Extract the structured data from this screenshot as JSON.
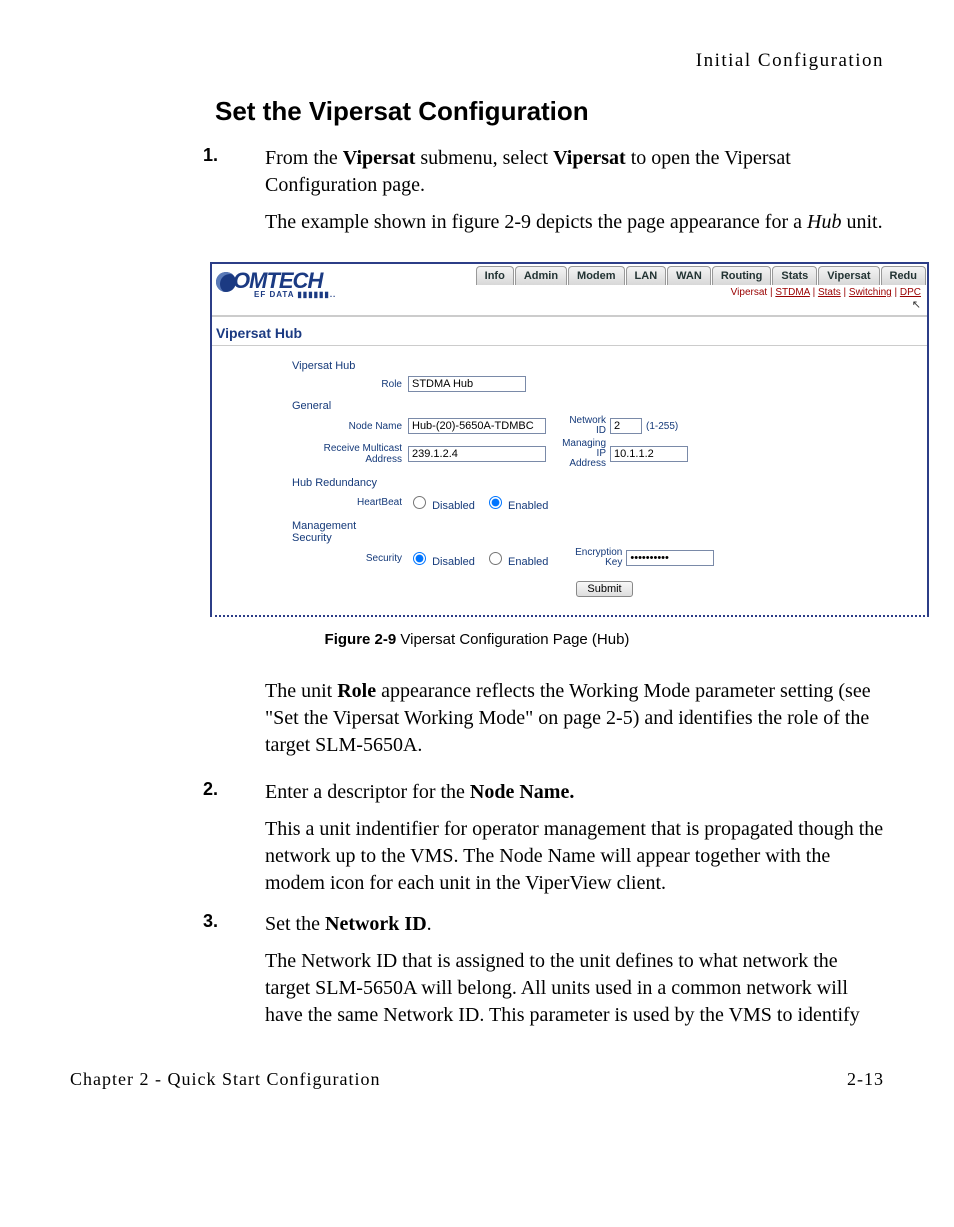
{
  "header": {
    "right": "Initial Configuration"
  },
  "section_title": "Set the Vipersat Configuration",
  "steps": {
    "s1_num": "1.",
    "s1_a": "From the ",
    "s1_b": "Vipersat",
    "s1_c": " submenu, select ",
    "s1_d": "Vipersat",
    "s1_e": " to open the Vipersat Configuration page.",
    "s1_follow_a": "The example shown in figure 2-9 depicts the page appearance for a ",
    "s1_follow_b": "Hub",
    "s1_follow_c": " unit.",
    "s2_num": "2.",
    "s2_a": "Enter a descriptor for the ",
    "s2_b": "Node Name.",
    "s2_follow": "This a unit indentifier for operator management that is propagated though the network up to the VMS. The Node Name will appear together with the modem icon for each unit in the ViperView client.",
    "s3_num": "3.",
    "s3_a": "Set the ",
    "s3_b": "Network ID",
    "s3_c": ".",
    "s3_follow": "The Network ID that is assigned to the unit defines to what network the target SLM-5650A will belong. All units used in a common network will have the same Network ID. This parameter is used by the VMS to identify"
  },
  "between_para_a": "The unit ",
  "between_para_b": "Role",
  "between_para_c": " appearance reflects the Working Mode parameter setting (see \"Set the Vipersat Working Mode\" on page 2-5) and identifies the role of the target SLM-5650A.",
  "figure": {
    "logo_main": "OMTECH",
    "logo_sub": "EF DATA ▮▮▮▮▮▮..",
    "tabs": [
      "Info",
      "Admin",
      "Modem",
      "LAN",
      "WAN",
      "Routing",
      "Stats",
      "Vipersat",
      "Redu"
    ],
    "sublinks": [
      "Vipersat",
      "STDMA",
      "Stats",
      "Switching",
      "DPC"
    ],
    "panel_title": "Vipersat Hub",
    "sec_hub_title": "Vipersat Hub",
    "role_label": "Role",
    "role_value": "STDMA Hub",
    "general_title": "General",
    "node_name_label": "Node Name",
    "node_name_value": "Hub-(20)-5650A-TDMBC",
    "network_id_label": "Network\nID",
    "network_id_value": "2",
    "network_id_hint": "(1-255)",
    "recv_mc_label": "Receive Multicast\nAddress",
    "recv_mc_value": "239.1.2.4",
    "managing_ip_label": "Managing\nIP\nAddress",
    "managing_ip_value": "10.1.1.2",
    "hub_red_title": "Hub Redundancy",
    "heartbeat_label": "HeartBeat",
    "disabled_label": "Disabled",
    "enabled_label": "Enabled",
    "mgmt_sec_title": "Management\nSecurity",
    "security_label": "Security",
    "enc_key_label": "Encryption\nKey",
    "enc_key_placeholder": "••••••••••",
    "submit_label": "Submit"
  },
  "caption": {
    "bold": "Figure 2-9",
    "rest": "   Vipersat Configuration Page (Hub)"
  },
  "footer": {
    "left": "Chapter 2 - Quick Start Configuration",
    "right": "2-13"
  }
}
